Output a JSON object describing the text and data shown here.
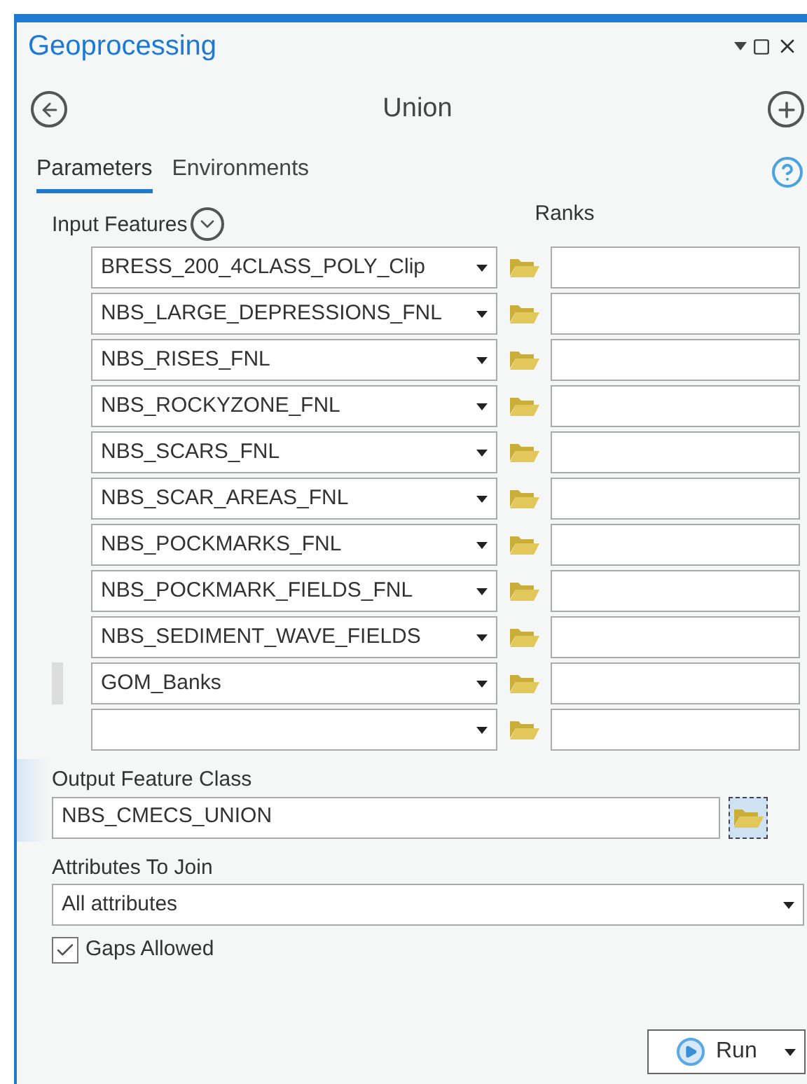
{
  "window": {
    "title": "Geoprocessing"
  },
  "tool": {
    "title": "Union"
  },
  "tabs": [
    {
      "label": "Parameters",
      "selected": true
    },
    {
      "label": "Environments",
      "selected": false
    }
  ],
  "input_features": {
    "label": "Input Features",
    "ranks_label": "Ranks",
    "rows": [
      {
        "value": "BRESS_200_4CLASS_POLY_Clip",
        "drag_handle": false
      },
      {
        "value": "NBS_LARGE_DEPRESSIONS_FNL",
        "drag_handle": false
      },
      {
        "value": "NBS_RISES_FNL",
        "drag_handle": false
      },
      {
        "value": "NBS_ROCKYZONE_FNL",
        "drag_handle": false
      },
      {
        "value": "NBS_SCARS_FNL",
        "drag_handle": false
      },
      {
        "value": "NBS_SCAR_AREAS_FNL",
        "drag_handle": false
      },
      {
        "value": "NBS_POCKMARKS_FNL",
        "drag_handle": false
      },
      {
        "value": "NBS_POCKMARK_FIELDS_FNL",
        "drag_handle": false
      },
      {
        "value": "NBS_SEDIMENT_WAVE_FIELDS",
        "drag_handle": false
      },
      {
        "value": "GOM_Banks",
        "drag_handle": true
      },
      {
        "drag_handle": false
      }
    ]
  },
  "output": {
    "label": "Output Feature Class",
    "value": "NBS_CMECS_UNION",
    "active": true
  },
  "attributes": {
    "label": "Attributes To Join",
    "value": "All attributes"
  },
  "gaps": {
    "label": "Gaps Allowed",
    "checked": true
  },
  "run_button": {
    "label": "Run"
  }
}
